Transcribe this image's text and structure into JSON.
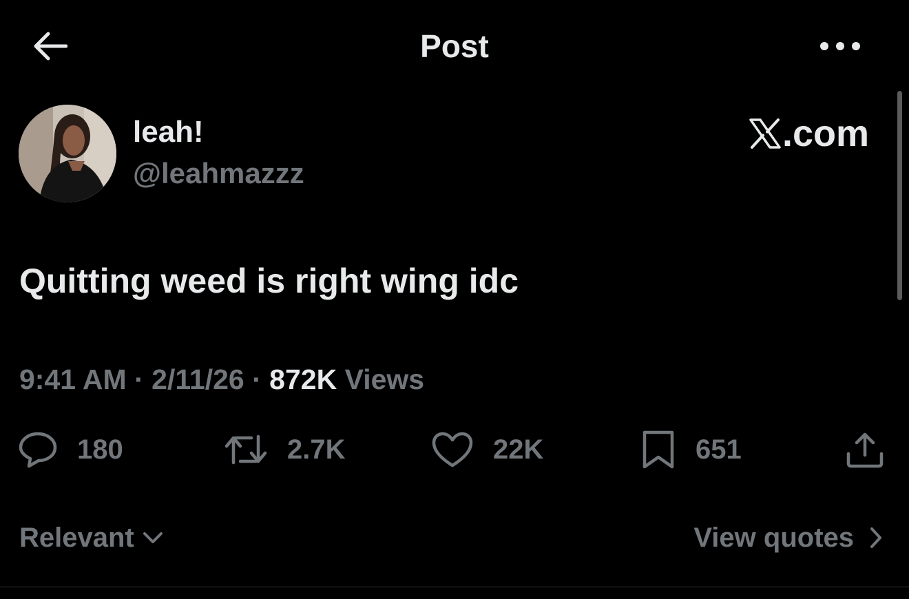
{
  "header": {
    "title": "Post",
    "back_icon": "arrow-left-icon",
    "more_icon": "more-horizontal-icon"
  },
  "author": {
    "display_name": "leah!",
    "handle": "@leahmazzz"
  },
  "watermark": {
    "text": ".com",
    "icon": "x-logo-icon"
  },
  "post": {
    "text": "Quitting weed is right wing idc",
    "time": "9:41 AM",
    "date": "2/11/26",
    "separator": "·",
    "views_count": "872K",
    "views_label": "Views"
  },
  "actions": {
    "replies": "180",
    "reposts": "2.7K",
    "likes": "22K",
    "bookmarks": "651"
  },
  "footer": {
    "sort_label": "Relevant",
    "quotes_label": "View quotes"
  },
  "colors": {
    "background": "#000000",
    "primary_text": "#e7e9ea",
    "secondary_text": "#71767b",
    "divider": "#2f3336"
  }
}
